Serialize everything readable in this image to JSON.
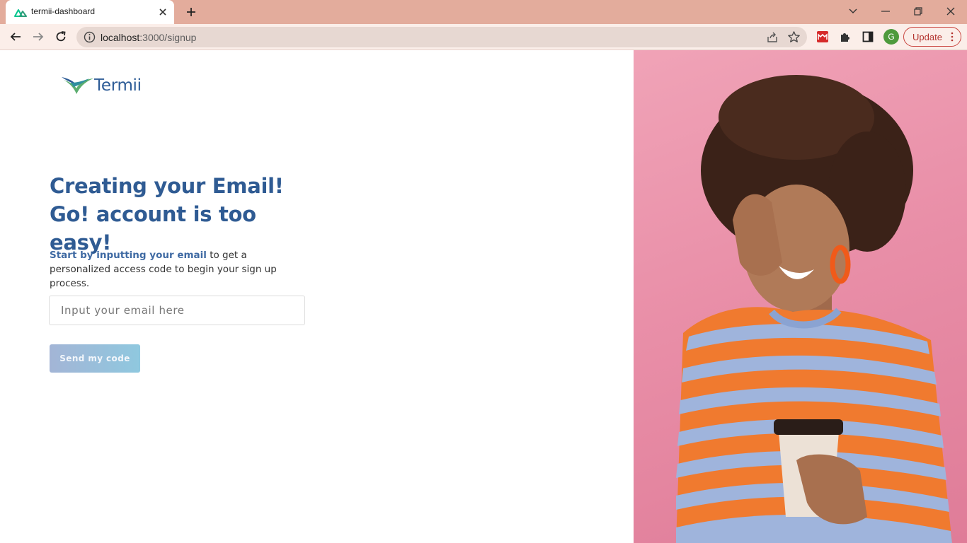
{
  "browser": {
    "tab_title": "termii-dashboard",
    "url_host": "localhost",
    "url_rest": ":3000/signup",
    "profile_initial": "G",
    "update_label": "Update"
  },
  "page": {
    "logo_text": "Termii",
    "headline": "Creating your Email! Go! account is too easy!",
    "subtext_highlight": "Start by inputting your email",
    "subtext_rest": " to get a personalized access code to begin your sign up process.",
    "email_placeholder": "Input your email here",
    "send_button_label": "Send my code"
  },
  "colors": {
    "tabbar": "#e3ac9c",
    "accent_blue": "#2f5b93",
    "photo_background": "#e98fa8"
  }
}
